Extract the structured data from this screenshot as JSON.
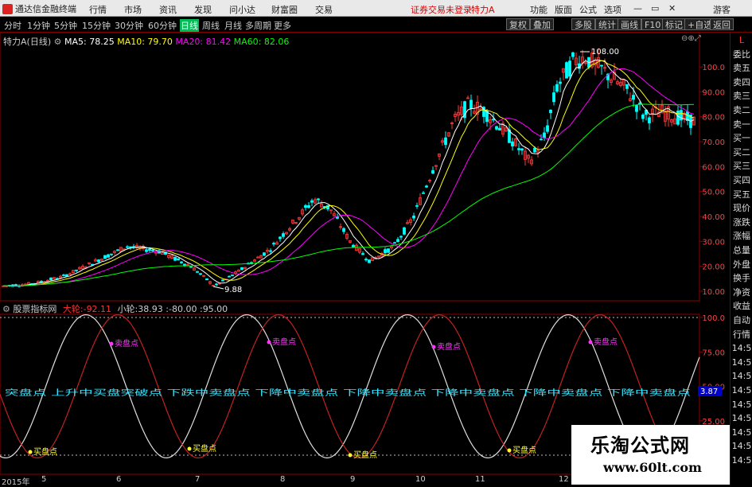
{
  "menubar": {
    "app_title": "通达信金融终端",
    "items": [
      "行情",
      "市场",
      "资讯",
      "发现",
      "问小达",
      "财富圈",
      "交易"
    ],
    "login_status": "证券交易未登录",
    "stock_name": "特力A",
    "right_items": [
      "功能",
      "版面",
      "公式",
      "选项"
    ],
    "guest": "游客"
  },
  "periods": [
    "分时",
    "1分钟",
    "5分钟",
    "15分钟",
    "30分钟",
    "60分钟",
    "日线",
    "周线",
    "月线",
    "多周期",
    "更多"
  ],
  "selected_period": "日线",
  "toolbar": [
    "复权",
    "叠加",
    "多股",
    "统计",
    "画线",
    "F10",
    "标记",
    "+自选",
    "返回"
  ],
  "main_legend": {
    "title": "特力A(日线)",
    "ma": [
      {
        "label": "MA5: 78.25",
        "color": "#ffffff"
      },
      {
        "label": "MA10: 79.70",
        "color": "#ffff00"
      },
      {
        "label": "MA20: 81.42",
        "color": "#ff00ff"
      },
      {
        "label": "MA60: 82.06",
        "color": "#00ff00"
      }
    ]
  },
  "price_axis": [
    "100.0",
    "90.00",
    "80.00",
    "70.00",
    "60.00",
    "50.00",
    "40.00",
    "30.00",
    "20.00",
    "10.00"
  ],
  "price_annotations": {
    "high": "108.00",
    "low": "9.88"
  },
  "right_panel": [
    "L",
    "委比",
    "卖五",
    "卖四",
    "卖三",
    "卖二",
    "卖一",
    "买一",
    "买二",
    "买三",
    "买四",
    "买五",
    "现价",
    "涨跌",
    "涨幅",
    "总量",
    "外盘",
    "换手",
    "净资",
    "收益",
    "自动",
    "行情",
    "14:5",
    "14:5",
    "14:5",
    "14:5",
    "14:5",
    "14:5",
    "14:5",
    "14:5",
    "14:5"
  ],
  "sub": {
    "name": "股票指标网",
    "big_label": "大轮:",
    "big_value": "-92.11",
    "small_label": "小轮:",
    "small_value": "38.93",
    "v3": "-80.00",
    "v4": "95.00",
    "axis": [
      "100.0",
      "75.00",
      "50.00",
      "25.00",
      "0.00",
      "-25.00"
    ],
    "current_value": "3.87",
    "buy_label": "买盘点",
    "sell_label": "卖盘点",
    "scroll_text": "突盘点 上升中买盘突破点 下跌中卖盘点 下降中卖盘点 下降中卖盘点 下降中卖盘点 下降中卖盘点 下降中卖盘点"
  },
  "date_axis": [
    "2015年",
    "5",
    "6",
    "7",
    "8",
    "9",
    "10",
    "11",
    "12"
  ],
  "watermark": {
    "cn": "乐淘公式网",
    "url": "www.60lt.com"
  },
  "colors": {
    "up": "#ff3b3b",
    "down": "#00ffff",
    "grid": "#8b0000",
    "ma5": "#ffffff",
    "ma10": "#ffff00",
    "ma20": "#ff00ff",
    "ma60": "#00ff00",
    "brand": "#dd2222"
  }
}
